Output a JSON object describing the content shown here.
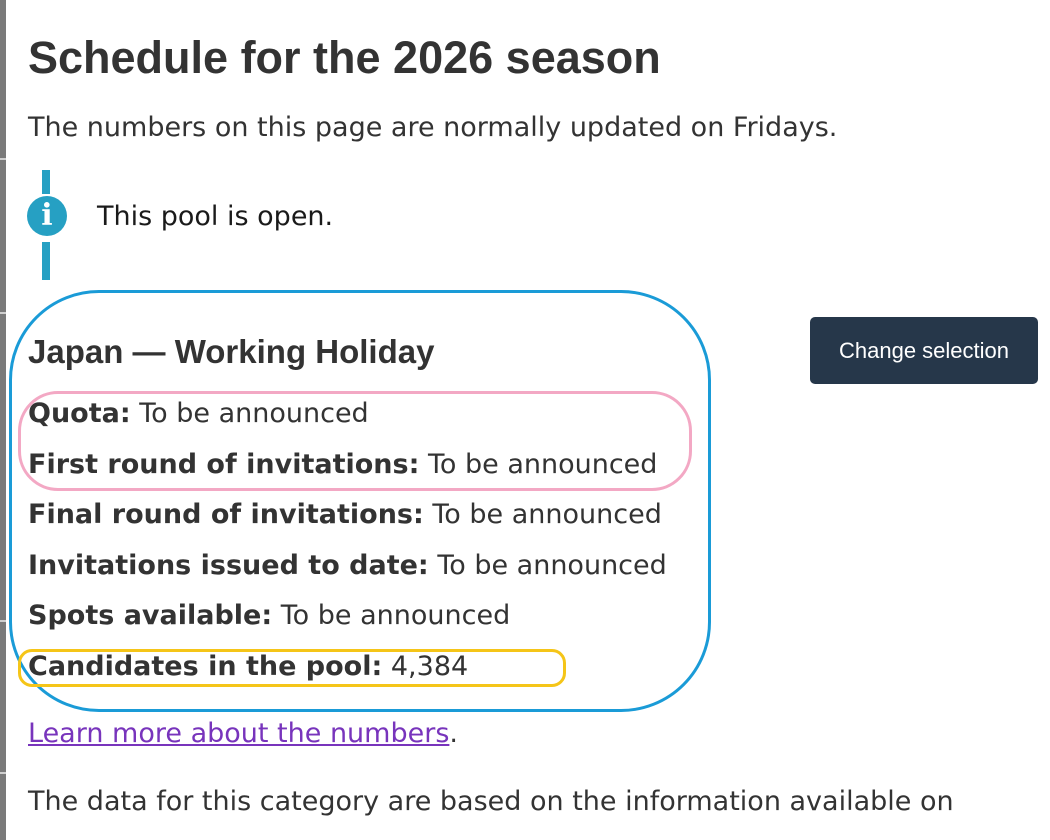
{
  "page": {
    "title": "Schedule for the 2026 season",
    "intro": "The numbers on this page are normally updated on Fridays."
  },
  "alert": {
    "icon": "info-icon",
    "icon_glyph": "i",
    "text": "This pool is open.",
    "color": "#26a0c3"
  },
  "category": {
    "title": "Japan — Working Holiday",
    "change_button_label": "Change selection",
    "facts": [
      {
        "label": "Quota:",
        "value": "To be announced"
      },
      {
        "label": "First round of invitations:",
        "value": "To be announced"
      },
      {
        "label": "Final round of invitations:",
        "value": "To be announced"
      },
      {
        "label": "Invitations issued to date:",
        "value": "To be announced"
      },
      {
        "label": "Spots available:",
        "value": "To be announced"
      },
      {
        "label": "Candidates in the pool:",
        "value": "4,384"
      }
    ]
  },
  "learn_more": {
    "link_text": "Learn more about the numbers",
    "trailing": "."
  },
  "footer": {
    "text": "The data for this category are based on the information available on"
  },
  "colors": {
    "button_bg": "#26374a",
    "link": "#7834bc",
    "annotation_blue": "#1a9bd7",
    "annotation_pink": "#f3a8c4",
    "annotation_yellow": "#f5c518"
  }
}
